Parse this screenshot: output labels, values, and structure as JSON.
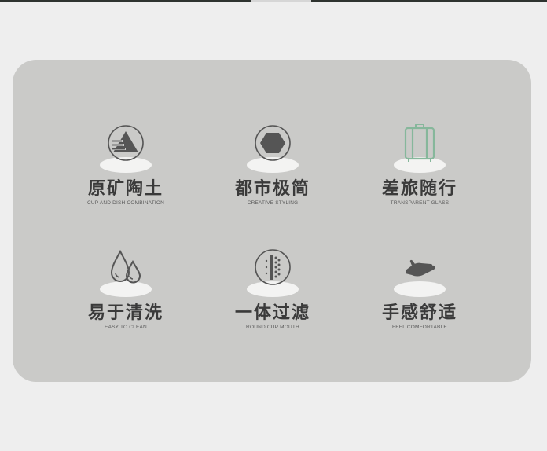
{
  "colors": {
    "background": "#eeeeee",
    "panel": "#cacac8",
    "icon_dark": "#555555",
    "icon_green": "#86b79b",
    "text": "#3a3a3a"
  },
  "features": [
    {
      "icon": "triangle-layers-icon",
      "title": "原矿陶土",
      "subtitle": "CUP AND DISH COMBINATION"
    },
    {
      "icon": "hexagon-icon",
      "title": "都市极简",
      "subtitle": "CREATIVE STYLING"
    },
    {
      "icon": "suitcase-icon",
      "title": "差旅随行",
      "subtitle": "TRANSPARENT GLASS"
    },
    {
      "icon": "water-drops-icon",
      "title": "易于清洗",
      "subtitle": "EASY TO CLEAN"
    },
    {
      "icon": "filter-mesh-icon",
      "title": "一体过滤",
      "subtitle": "ROUND CUP MOUTH"
    },
    {
      "icon": "hand-icon",
      "title": "手感舒适",
      "subtitle": "FEEL COMFORTABLE"
    }
  ]
}
